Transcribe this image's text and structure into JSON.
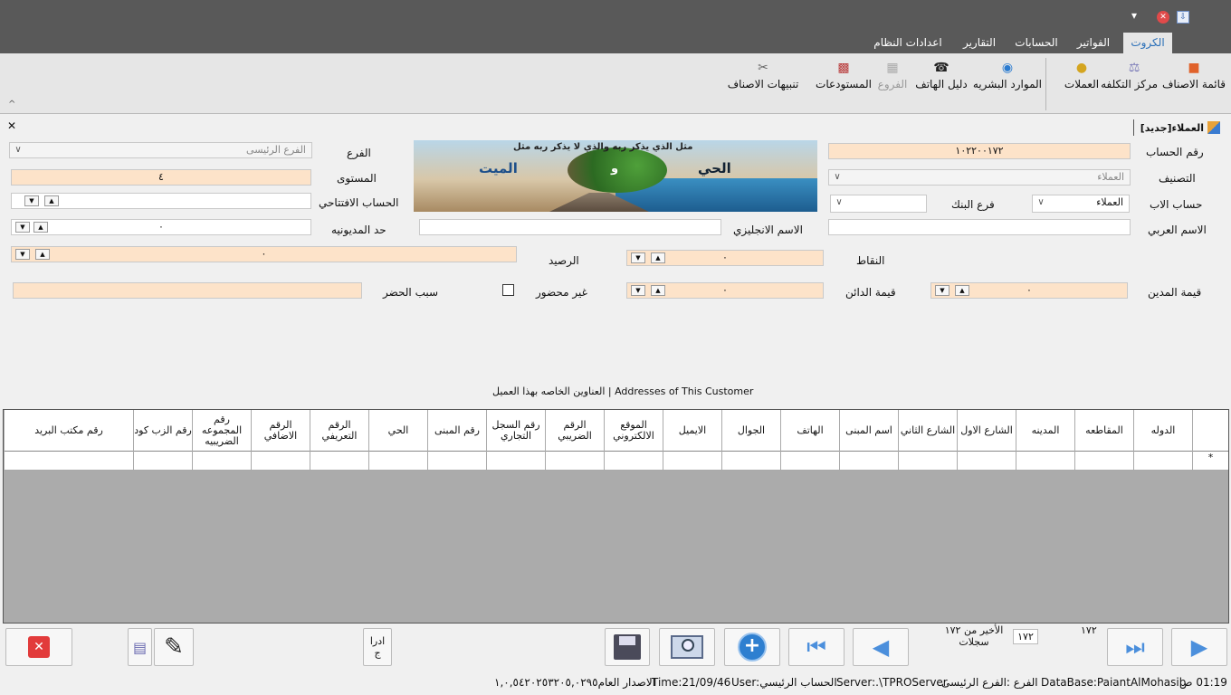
{
  "window": {
    "controls": {
      "menu": "▾",
      "close": "✕",
      "app": "⇩"
    }
  },
  "tabs": [
    "الكروت",
    "الفواتير",
    "الحسابات",
    "التقارير",
    "اعدادات النظام"
  ],
  "ribbon": {
    "items": [
      {
        "label": "قائمة الاصناف",
        "icon": "items-list-icon"
      },
      {
        "label": "مركز التكلفه",
        "icon": "cost-center-icon"
      },
      {
        "label": "العملات",
        "icon": "currencies-icon"
      },
      {
        "label": "الموارد البشريه",
        "icon": "globe-icon"
      },
      {
        "label": "دليل الهاتف",
        "icon": "phone-icon"
      },
      {
        "label": "الفروع",
        "icon": "branches-icon"
      },
      {
        "label": "المستودعات",
        "icon": "warehouses-icon"
      },
      {
        "label": "تنبيهات الاصناف",
        "icon": "items-alerts-icon"
      }
    ],
    "collapse": "^"
  },
  "form": {
    "title": "العملاء[جديد]",
    "close": "✕",
    "labels": {
      "account_no": "رقم الحساب",
      "classification": "التصنيف",
      "parent_account": "حساب الاب",
      "bank_branch": "فرع البنك",
      "arabic_name": "الاسم العربي",
      "english_name": "الاسم الانجليزي",
      "branch": "الفرع",
      "level": "المستوى",
      "opening_account": "الحساب الافتتاحي",
      "credit_limit": "حد المديونيه",
      "points": "النقاط",
      "balance": "الرصيد",
      "debit_value": "قيمة المدين",
      "credit_value": "قيمة الدائن",
      "not_present": "غير محضور",
      "ban_reason": "سبب الحضر"
    },
    "values": {
      "account_no": "١٠٢٢٠٠١٧٢",
      "classification": "العملاء",
      "parent_account": "العملاء",
      "bank_branch": "",
      "arabic_name": "",
      "english_name": "",
      "branch": "الفرع الرئيسى",
      "level": "٤",
      "opening_account": "",
      "credit_limit": "٠",
      "points": "٠",
      "balance": "٠",
      "debit_value": "٠",
      "credit_value": "٠",
      "ban_reason": ""
    },
    "spin": {
      "up": "▲",
      "down": "▼"
    },
    "banner": {
      "caption": "مثل الذي يذكر ربه والذي لا يذكر ربه مثل",
      "left_word": "الميت",
      "right_word": "الحي",
      "middle": "و"
    }
  },
  "addresses": {
    "title": "العناوين الخاصه بهذا العميل | Addresses of This Customer",
    "columns": [
      "الدوله",
      "المقاطعه",
      "المدينه",
      "الشارع الاول",
      "الشارع الثاني",
      "اسم المبنى",
      "الهاتف",
      "الجوال",
      "الايميل",
      "الموقع الالكتروني",
      "الرقم الضريبي",
      "رقم السجل التجاري",
      "رقم المبنى",
      "الحي",
      "الرقم التعريفي",
      "الرقم الاضافي",
      "رقم المجموعه الضريبيه",
      "رقم الزب كود",
      "رقم مكتب البريد"
    ],
    "new_row_marker": "*"
  },
  "navigation": {
    "record_total": "١٧٢",
    "record_current": "١٧٢",
    "record_text": "الأخير من ١٧٢ سجلات",
    "admin_label": "ادرا ج"
  },
  "statusbar": {
    "time": "01:19 ص",
    "database": "DataBase:PaiantAlMohasib",
    "branch": "الفرع :الفرع الرئيسى",
    "server": "Server:.\\TPROServer",
    "user": "User:الحساب الرئيسي",
    "date": "Time:21/09/46",
    "version": "الاصدار العام١,٠,٥٤٢٠٢٥٣٢٠٥,٠٢٩٥"
  },
  "colors": {
    "titlebar": "#595959",
    "ribbon": "#e6e6e6",
    "peach": "#fde3c9",
    "grid_bg": "#ababab",
    "tab_active_text": "#2a6fb8"
  }
}
